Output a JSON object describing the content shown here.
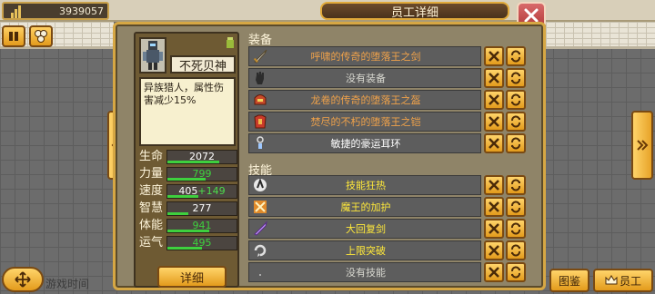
{
  "hud": {
    "money": "3939057",
    "game_time_label": "游戏时间"
  },
  "dialog": {
    "title": "员工详细",
    "employee": {
      "name": "不死贝神",
      "description": "异族猎人，属性伤害减少15%",
      "stats": [
        {
          "label": "生命",
          "value": "2072",
          "bonus": "",
          "value_color": "#ffffff",
          "fill": 0.75
        },
        {
          "label": "力量",
          "value": "799",
          "bonus": "",
          "value_color": "#3ed03e",
          "fill": 0.55
        },
        {
          "label": "速度",
          "value": "405",
          "bonus": "+149",
          "value_color": "#ffffff",
          "fill": 0.45
        },
        {
          "label": "智慧",
          "value": "277",
          "bonus": "",
          "value_color": "#ffffff",
          "fill": 0.3
        },
        {
          "label": "体能",
          "value": "941",
          "bonus": "",
          "value_color": "#3ed03e",
          "fill": 0.6
        },
        {
          "label": "运气",
          "value": "495",
          "bonus": "",
          "value_color": "#3ed03e",
          "fill": 0.5
        }
      ],
      "detail_button": "详细"
    },
    "equipment": {
      "title": "装备",
      "items": [
        {
          "name": "呼啸的传奇的堕落王之剑",
          "color_class": "txt-orange",
          "icon": "sword-icon"
        },
        {
          "name": "没有装备",
          "color_class": "txt-gray",
          "icon": "glove-icon"
        },
        {
          "name": "龙卷的传奇的堕落王之盔",
          "color_class": "txt-orange",
          "icon": "helmet-icon"
        },
        {
          "name": "焚尽的不朽的堕落王之铠",
          "color_class": "txt-orange",
          "icon": "armor-icon"
        },
        {
          "name": "敏捷的豪运耳环",
          "color_class": "txt-white",
          "icon": "earring-icon"
        }
      ]
    },
    "skills": {
      "title": "技能",
      "items": [
        {
          "name": "技能狂热",
          "color_class": "txt-yellow",
          "icon": "skill-frenzy-icon"
        },
        {
          "name": "魔王的加护",
          "color_class": "txt-yellow",
          "icon": "skill-protection-icon"
        },
        {
          "name": "大回复剑",
          "color_class": "txt-yellow",
          "icon": "skill-sword-icon"
        },
        {
          "name": "上限突破",
          "color_class": "txt-yellow",
          "icon": "skill-breakthrough-icon"
        },
        {
          "name": "没有技能",
          "color_class": "txt-gray",
          "icon": "empty-skill-icon"
        }
      ]
    }
  },
  "bottom": {
    "atlas_label": "图鉴",
    "staff_label": "员工"
  },
  "colors": {
    "accent_gold": "#e39b1c",
    "panel_bg": "#8f8468",
    "close_red": "#b33a3a"
  }
}
